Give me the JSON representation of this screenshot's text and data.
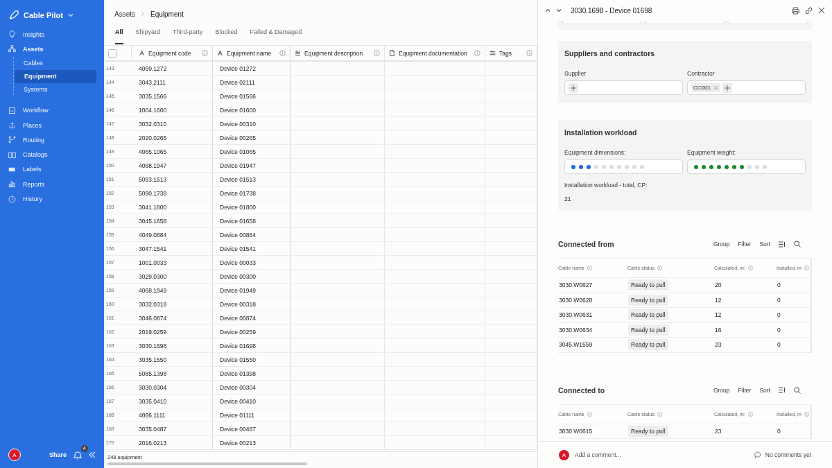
{
  "sidebar": {
    "app_name": "Cable Pilot",
    "items": [
      {
        "label": "Insights",
        "selected": false
      },
      {
        "label": "Assets",
        "selected": false,
        "children": [
          {
            "label": "Cables",
            "selected": false
          },
          {
            "label": "Equipment",
            "selected": true
          },
          {
            "label": "Systems",
            "selected": false
          }
        ]
      },
      {
        "label": "Workflow",
        "selected": false
      },
      {
        "label": "Places",
        "selected": false
      },
      {
        "label": "Routing",
        "selected": false
      },
      {
        "label": "Catalogs",
        "selected": false
      },
      {
        "label": "Labels",
        "selected": false
      },
      {
        "label": "Reports",
        "selected": false
      },
      {
        "label": "History",
        "selected": false
      }
    ],
    "user_initial": "A",
    "share": "Share",
    "notifications": "4"
  },
  "breadcrumb": [
    "Assets",
    "Equipment"
  ],
  "tabs": [
    {
      "label": "All",
      "selected": true
    },
    {
      "label": "Shipyard",
      "selected": false
    },
    {
      "label": "Third-party",
      "selected": false
    },
    {
      "label": "Blocked",
      "selected": false
    },
    {
      "label": "Failed & Damaged",
      "selected": false
    }
  ],
  "table": {
    "all_checked": false,
    "columns": [
      {
        "label": "Equipment code"
      },
      {
        "label": "Equipment name"
      },
      {
        "label": "Equipment description"
      },
      {
        "label": "Equipment documentation"
      },
      {
        "label": "Tags"
      }
    ],
    "rows": [
      {
        "number": "143",
        "code": "4069.1272",
        "name": "Device 01272"
      },
      {
        "number": "144",
        "code": "3043.2111",
        "name": "Device 02111"
      },
      {
        "number": "145",
        "code": "3035.1566",
        "name": "Device 01566"
      },
      {
        "number": "146",
        "code": "1004.1600",
        "name": "Device 01600"
      },
      {
        "number": "147",
        "code": "3032.0310",
        "name": "Device 00310"
      },
      {
        "number": "148",
        "code": "2020.0265",
        "name": "Device 00265"
      },
      {
        "number": "149",
        "code": "4065.1065",
        "name": "Device 01065"
      },
      {
        "number": "150",
        "code": "4068.1947",
        "name": "Device 01947"
      },
      {
        "number": "151",
        "code": "5093.1513",
        "name": "Device 01513"
      },
      {
        "number": "152",
        "code": "5090.1738",
        "name": "Device 01738"
      },
      {
        "number": "153",
        "code": "3041.1800",
        "name": "Device 01800"
      },
      {
        "number": "154",
        "code": "3045.1658",
        "name": "Device 01658"
      },
      {
        "number": "155",
        "code": "4049.0884",
        "name": "Device 00884"
      },
      {
        "number": "156",
        "code": "3047.1541",
        "name": "Device 01541"
      },
      {
        "number": "157",
        "code": "1001.0033",
        "name": "Device 00033"
      },
      {
        "number": "158",
        "code": "3029.0300",
        "name": "Device 00300"
      },
      {
        "number": "159",
        "code": "4068.1949",
        "name": "Device 01949"
      },
      {
        "number": "160",
        "code": "3032.0318",
        "name": "Device 00318"
      },
      {
        "number": "161",
        "code": "3046.0874",
        "name": "Device 00874"
      },
      {
        "number": "162",
        "code": "2019.0259",
        "name": "Device 00259"
      },
      {
        "number": "163",
        "code": "3030.1698",
        "name": "Device 01698"
      },
      {
        "number": "164",
        "code": "3035.1550",
        "name": "Device 01550"
      },
      {
        "number": "165",
        "code": "5085.1398",
        "name": "Device 01398"
      },
      {
        "number": "166",
        "code": "3030.0304",
        "name": "Device 00304"
      },
      {
        "number": "167",
        "code": "3035.0410",
        "name": "Device 00410"
      },
      {
        "number": "168",
        "code": "4066.1111",
        "name": "Device 01111"
      },
      {
        "number": "169",
        "code": "3035.0487",
        "name": "Device 00487"
      },
      {
        "number": "170",
        "code": "2016.0213",
        "name": "Device 00213"
      }
    ],
    "count": "248 equipment"
  },
  "panel": {
    "title": "3030.1698 - Device 01698",
    "suppliers": {
      "title": "Suppliers and contractors",
      "fields": [
        {
          "label": "Supplier"
        },
        {
          "label": "Contractor",
          "chips": [
            "CC001"
          ]
        }
      ]
    },
    "installation": {
      "title": "Installation workload",
      "ratings": [
        {
          "label": "Equipment dimensions:",
          "stars": 3,
          "color": "#1f66e0"
        },
        {
          "label": "Equipment weight:",
          "stars": 7,
          "color": "#1a8a2e"
        }
      ],
      "total_label": "Installation workload - total, CP:",
      "total": "21"
    },
    "connections": [
      {
        "title": "Connected from",
        "actions": [
          "Group",
          "Filter",
          "Sort"
        ],
        "columns": [
          "Cable name",
          "Cable status",
          "Calculated, m:",
          "Installed, m"
        ],
        "rows": [
          {
            "name": "3030.W0627",
            "status": "Ready to pull",
            "calculated": "20",
            "installed": "0"
          },
          {
            "name": "3030.W0628",
            "status": "Ready to pull",
            "calculated": "12",
            "installed": "0"
          },
          {
            "name": "3030.W0631",
            "status": "Ready to pull",
            "calculated": "12",
            "installed": "0"
          },
          {
            "name": "3030.W0634",
            "status": "Ready to pull",
            "calculated": "16",
            "installed": "0"
          },
          {
            "name": "3045.W1559",
            "status": "Ready to pull",
            "calculated": "23",
            "installed": "0"
          }
        ]
      },
      {
        "title": "Connected to",
        "actions": [
          "Group",
          "Filter",
          "Sort"
        ],
        "columns": [
          "Cable name",
          "Cable status",
          "Calculated, m:",
          "Installed, m"
        ],
        "rows": [
          {
            "name": "3030.W0615",
            "status": "Ready to pull",
            "calculated": "23",
            "installed": "0"
          }
        ]
      }
    ],
    "comment": {
      "user_initial": "A",
      "placeholder": "Add a comment...",
      "status": "No comments yet"
    }
  }
}
